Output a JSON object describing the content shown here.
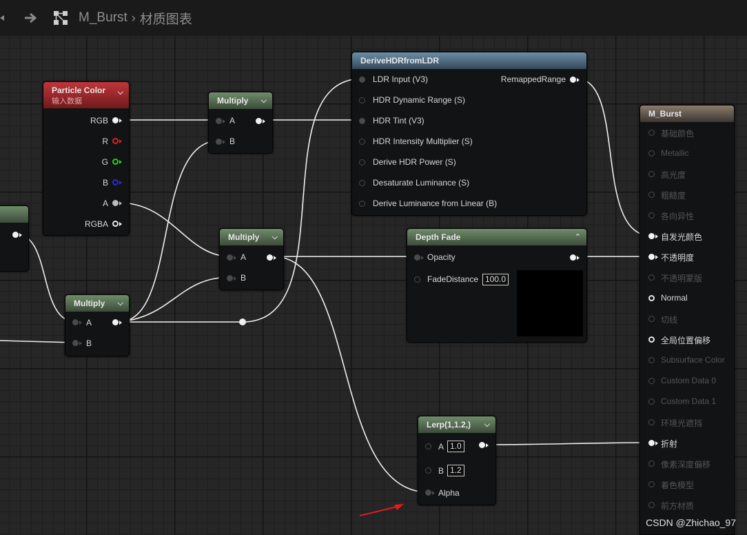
{
  "toolbar": {
    "breadcrumb_asset": "M_Burst",
    "breadcrumb_separator": "›",
    "breadcrumb_graph": "材质图表",
    "back_icon": "arrow-back-icon",
    "forward_icon": "arrow-forward-icon",
    "graph_icon": "graph-icon"
  },
  "nodes": {
    "particle_color": {
      "title": "Particle Color",
      "subtitle": "输入数据",
      "outputs": [
        "RGB",
        "R",
        "G",
        "B",
        "A",
        "RGBA"
      ]
    },
    "multiply_top": {
      "title": "Multiply",
      "inputs": [
        "A",
        "B"
      ]
    },
    "multiply_mid": {
      "title": "Multiply",
      "inputs": [
        "A",
        "B"
      ]
    },
    "multiply_low": {
      "title": "Multiply",
      "inputs": [
        "A",
        "B"
      ]
    },
    "derive_hdr": {
      "title": "DeriveHDRfromLDR",
      "inputs": [
        "LDR Input (V3)",
        "HDR Dynamic Range (S)",
        "HDR Tint (V3)",
        "HDR Intensity Multiplier (S)",
        "Derive HDR Power (S)",
        "Desaturate Luminance (S)",
        "Derive Luminance from Linear (B)"
      ],
      "output": "RemappedRange"
    },
    "depth_fade": {
      "title": "Depth Fade",
      "inputs": [
        "Opacity",
        "FadeDistance"
      ],
      "fade_distance_value": "100.0"
    },
    "lerp": {
      "title": "Lerp(1,1.2,)",
      "inputs": [
        "A",
        "B",
        "Alpha"
      ],
      "a_value": "1.0",
      "b_value": "1.2"
    },
    "result": {
      "title": "M_Burst",
      "pins": [
        {
          "label": "基础颜色",
          "active": false
        },
        {
          "label": "Metallic",
          "active": false
        },
        {
          "label": "高光度",
          "active": false
        },
        {
          "label": "粗糙度",
          "active": false
        },
        {
          "label": "各向异性",
          "active": false
        },
        {
          "label": "自发光颜色",
          "active": true
        },
        {
          "label": "不透明度",
          "active": true
        },
        {
          "label": "不透明蒙版",
          "active": false
        },
        {
          "label": "Normal",
          "active": true
        },
        {
          "label": "切线",
          "active": false
        },
        {
          "label": "全局位置偏移",
          "active": true
        },
        {
          "label": "Subsurface Color",
          "active": false
        },
        {
          "label": "Custom Data 0",
          "active": false
        },
        {
          "label": "Custom Data 1",
          "active": false
        },
        {
          "label": "环境光遮挡",
          "active": false
        },
        {
          "label": "折射",
          "active": true
        },
        {
          "label": "像素深度偏移",
          "active": false
        },
        {
          "label": "着色模型",
          "active": false
        },
        {
          "label": "前方材质",
          "active": false
        }
      ]
    }
  },
  "watermark": "CSDN @Zhichao_97",
  "colors": {
    "graph_bg": "#262626",
    "wire": "#f0f0f0",
    "pin_red": "#e61e1e",
    "pin_green": "#1ed41e",
    "pin_blue": "#2a2ae0",
    "annotation_arrow": "#e11b1b"
  }
}
